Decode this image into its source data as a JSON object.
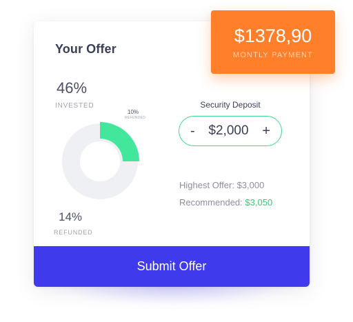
{
  "card": {
    "title": "Your Offer",
    "invested": {
      "percent": "46%",
      "label": "INVESTED"
    },
    "segment": {
      "percent": "10%",
      "label": "REFUNDED"
    },
    "refunded": {
      "percent": "14%",
      "label": "REFUNDED"
    },
    "donut": {
      "highlight_fraction": 0.25,
      "highlight_color": "#42e79b",
      "track_color": "#eef0f4"
    },
    "deposit": {
      "label": "Security Deposit",
      "minus": "-",
      "value": "$2,000",
      "plus": "+"
    },
    "highest_offer": "Highest Offer: $3,000",
    "recommended_label": "Recommended:",
    "recommended_value": "$3,050",
    "submit_label": "Submit Offer"
  },
  "payment": {
    "amount": "$1378,90",
    "label": "MONTLY PAYMENT"
  },
  "colors": {
    "accent": "#3f3bec",
    "orange": "#ff7f2a",
    "green": "#3fd98a"
  }
}
